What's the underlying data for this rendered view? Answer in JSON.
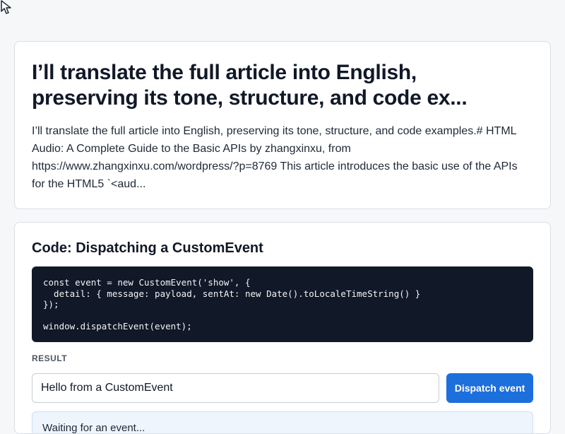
{
  "article": {
    "title_line1": "I’ll translate the full article into English,",
    "title_line2": "preserving its tone, structure, and code ex...",
    "excerpt": "I’ll translate the full article into English, preserving its tone, structure, and code examples.# HTML Audio: A Complete Guide to the Basic APIs by zhangxinxu, from https://www.zhangxinxu.com/wordpress/?p=8769 This article introduces the basic use of the APIs for the HTML5 `<aud..."
  },
  "code_section": {
    "title": "Code: Dispatching a CustomEvent",
    "code": "const event = new CustomEvent('show', {\n  detail: { message: payload, sentAt: new Date().toLocaleTimeString() }\n});\n\nwindow.dispatchEvent(event);",
    "result_label": "RESULT",
    "input_value": "Hello from a CustomEvent",
    "button_label": "Dispatch event",
    "status_text": "Waiting for an event..."
  },
  "colors": {
    "accent": "#1d6fdc",
    "code_background": "#111827",
    "status_background": "#eef5fd"
  },
  "icons": {
    "cursor": "mouse-pointer-icon"
  }
}
